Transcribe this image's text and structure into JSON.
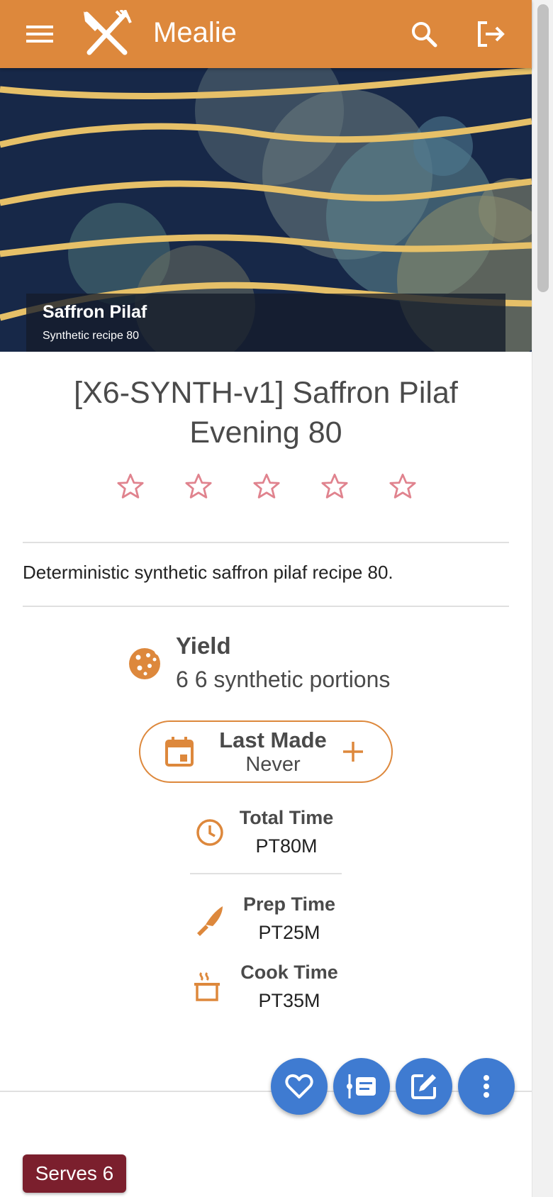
{
  "app": {
    "title": "Mealie"
  },
  "hero": {
    "caption_title": "Saffron Pilaf",
    "caption_subtitle": "Synthetic recipe 80"
  },
  "recipe": {
    "title": "[X6-SYNTH-v1] Saffron Pilaf Evening 80",
    "rating": {
      "value": 0,
      "max": 5
    },
    "description": "Deterministic synthetic saffron pilaf recipe 80.",
    "yield": {
      "label": "Yield",
      "value": "6 6 synthetic portions"
    },
    "last_made": {
      "label": "Last Made",
      "value": "Never"
    },
    "times": {
      "total": {
        "label": "Total Time",
        "value": "PT80M"
      },
      "prep": {
        "label": "Prep Time",
        "value": "PT25M"
      },
      "cook": {
        "label": "Cook Time",
        "value": "PT35M"
      }
    },
    "serves_label": "Serves 6"
  },
  "icons": {
    "menu": "hamburger-icon",
    "logo": "fork-knife-icon",
    "search": "search-icon",
    "logout": "logout-icon",
    "star": "star-outline-icon",
    "yield": "cookie-icon",
    "calendar": "calendar-icon",
    "add": "plus-icon",
    "total_time": "clock-icon",
    "prep_time": "knife-icon",
    "cook_time": "pot-steam-icon",
    "favorite": "heart-outline-icon",
    "timeline": "timeline-text-icon",
    "edit": "edit-icon",
    "more": "dots-vertical-icon"
  },
  "colors": {
    "primary": "#dd883c",
    "fab": "#3f7bd1",
    "star": "#e0838e",
    "serves_badge": "#7b1f2d"
  }
}
